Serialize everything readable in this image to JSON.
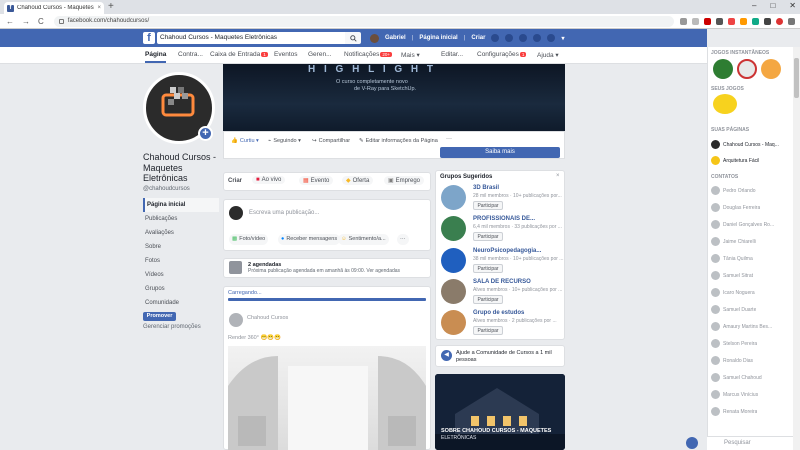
{
  "browser": {
    "tab_title": "Chahoud Cursos - Maquetes Ele...",
    "url": "facebook.com/chahoudcursos/",
    "tab_close": "×",
    "new_tab": "+",
    "win_min": "–",
    "win_max": "□",
    "win_close": "✕",
    "back": "←",
    "forward": "→",
    "reload": "C"
  },
  "fb": {
    "logo": "f",
    "search_value": "Chahoud Cursos - Maquetes Eletrônicas",
    "user": "Gabriel",
    "home": "Página inicial",
    "create": "Criar"
  },
  "page_tabs": [
    {
      "label": "Página",
      "active": true
    },
    {
      "label": "Contra..."
    },
    {
      "label": "Caixa de Entrada",
      "badge": "1"
    },
    {
      "label": "Eventos"
    },
    {
      "label": "Geren..."
    },
    {
      "label": "Notificações",
      "badge": "20+"
    },
    {
      "label": "Mais ▾"
    },
    {
      "label": "Editar..."
    },
    {
      "label": "Configurações",
      "badge": "1"
    },
    {
      "label": "Ajuda ▾"
    }
  ],
  "page": {
    "name": "Chahoud Cursos - Maquetes Eletrônicas",
    "handle": "@chahoudcursos",
    "nav": [
      "Página inicial",
      "Publicações",
      "Avaliações",
      "Sobre",
      "Fotos",
      "Vídeos",
      "Grupos",
      "Comunidade"
    ],
    "promote": "Promover",
    "manage_promos": "Gerenciar promoções",
    "avatar_plus": "+"
  },
  "cover": {
    "title": "H I G H L I G H T",
    "sub1": "O curso completamente novo",
    "sub2": "de V-Ray para SketchUp."
  },
  "actions": {
    "like": "Curtiu ▾",
    "follow": "Seguindo ▾",
    "share": "Compartilhar",
    "edit_info": "Editar informações da Página",
    "more": "···",
    "learn_more": "Saiba mais"
  },
  "create_bar": {
    "label": "Criar",
    "live": "Ao vivo",
    "event": "Evento",
    "offer": "Oferta",
    "job": "Emprego"
  },
  "composer": {
    "placeholder": "Escreva uma publicação...",
    "photo": "Foto/vídeo",
    "messages": "Receber mensagens",
    "feeling": "Sentimento/a...",
    "more": "···"
  },
  "scheduled": {
    "title": "2 agendadas",
    "text": "Próxima publicação agendada em amanhã às 09:00. Ver agendadas"
  },
  "upload": {
    "label": "Carregando...",
    "author": "Chahoud Cursos",
    "text": "Render 360° 😁😁😁"
  },
  "groups": {
    "title": "Grupos Sugeridos",
    "close": "×",
    "items": [
      {
        "name": "3D Brasil",
        "meta": "28 mil membros · 10+ publicações por...",
        "join": "Participar"
      },
      {
        "name": "PROFISSIONAIS DE...",
        "meta": "6,4 mil membros · 33 publicações por ...",
        "join": "Participar"
      },
      {
        "name": "NeuroPsicopedagogia...",
        "meta": "38 mil membros · 10+ publicações por ...",
        "join": "Participar"
      },
      {
        "name": "SALA DE RECURSO",
        "meta": "Alves membros · 10+ publicações por ...",
        "join": "Participar"
      },
      {
        "name": "Grupo de estudos",
        "meta": "Alves membros · 2 publicações por ...",
        "join": "Participar"
      }
    ]
  },
  "help": {
    "text": "Ajude a Comunidade de Cursos a 1 mil pessoas"
  },
  "ad": {
    "line1": "SOBRE CHAHOUD CURSOS - MAQUETES",
    "line2": "ELETRÔNICAS"
  },
  "sidebar": {
    "instant_games": "JOGOS INSTANTÂNEOS",
    "your_games": "SEUS JOGOS",
    "your_pages": "SUAS PÁGINAS",
    "pages": [
      "Chahoud Cursos - Maq...",
      "Arquitetura Fácil"
    ],
    "contacts_header": "CONTATOS",
    "contacts": [
      "Pedro Orlando",
      "Douglas Ferreira",
      "Daniel Gonçalves Ro...",
      "Jaime Chiarelli",
      "Tânia Quilma",
      "Samuel Sitrat",
      "Icaro Noguera",
      "Samuel Duarte",
      "Amaury Martins Bes...",
      "Stelson Pereira",
      "Ronaldo Dias",
      "Samuel Chahoud",
      "Marcus Vinícius",
      "Renata Moreira"
    ],
    "search_placeholder": "Pesquisar"
  },
  "colors": {
    "fb_blue": "#4267b2",
    "link": "#365899",
    "badge": "#fa3e3e"
  }
}
